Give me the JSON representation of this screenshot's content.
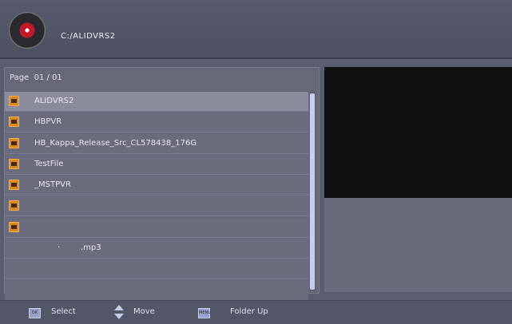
{
  "header": {
    "path": "C:/ALIDVRS2"
  },
  "browser": {
    "page_label": "Page",
    "page_value": "01 / 01",
    "items": [
      {
        "name": "ALIDVRS2",
        "folder": true,
        "selected": true
      },
      {
        "name": "HBPVR",
        "folder": true,
        "selected": false
      },
      {
        "name": "HB_Kappa_Release_Src_CL578438_176G",
        "folder": true,
        "selected": false
      },
      {
        "name": "TestFile",
        "folder": true,
        "selected": false
      },
      {
        "name": "_MSTPVR",
        "folder": true,
        "selected": false
      },
      {
        "name": "",
        "folder": true,
        "selected": false
      },
      {
        "name": "",
        "folder": true,
        "selected": false
      },
      {
        "name": ".mp3",
        "folder": false,
        "selected": false
      },
      {
        "name": "",
        "folder": false,
        "selected": false
      },
      {
        "name": "",
        "folder": false,
        "selected": false
      }
    ]
  },
  "footer": {
    "select_label": "Select",
    "move_label": "Move",
    "folder_up_label": "Folder Up"
  }
}
